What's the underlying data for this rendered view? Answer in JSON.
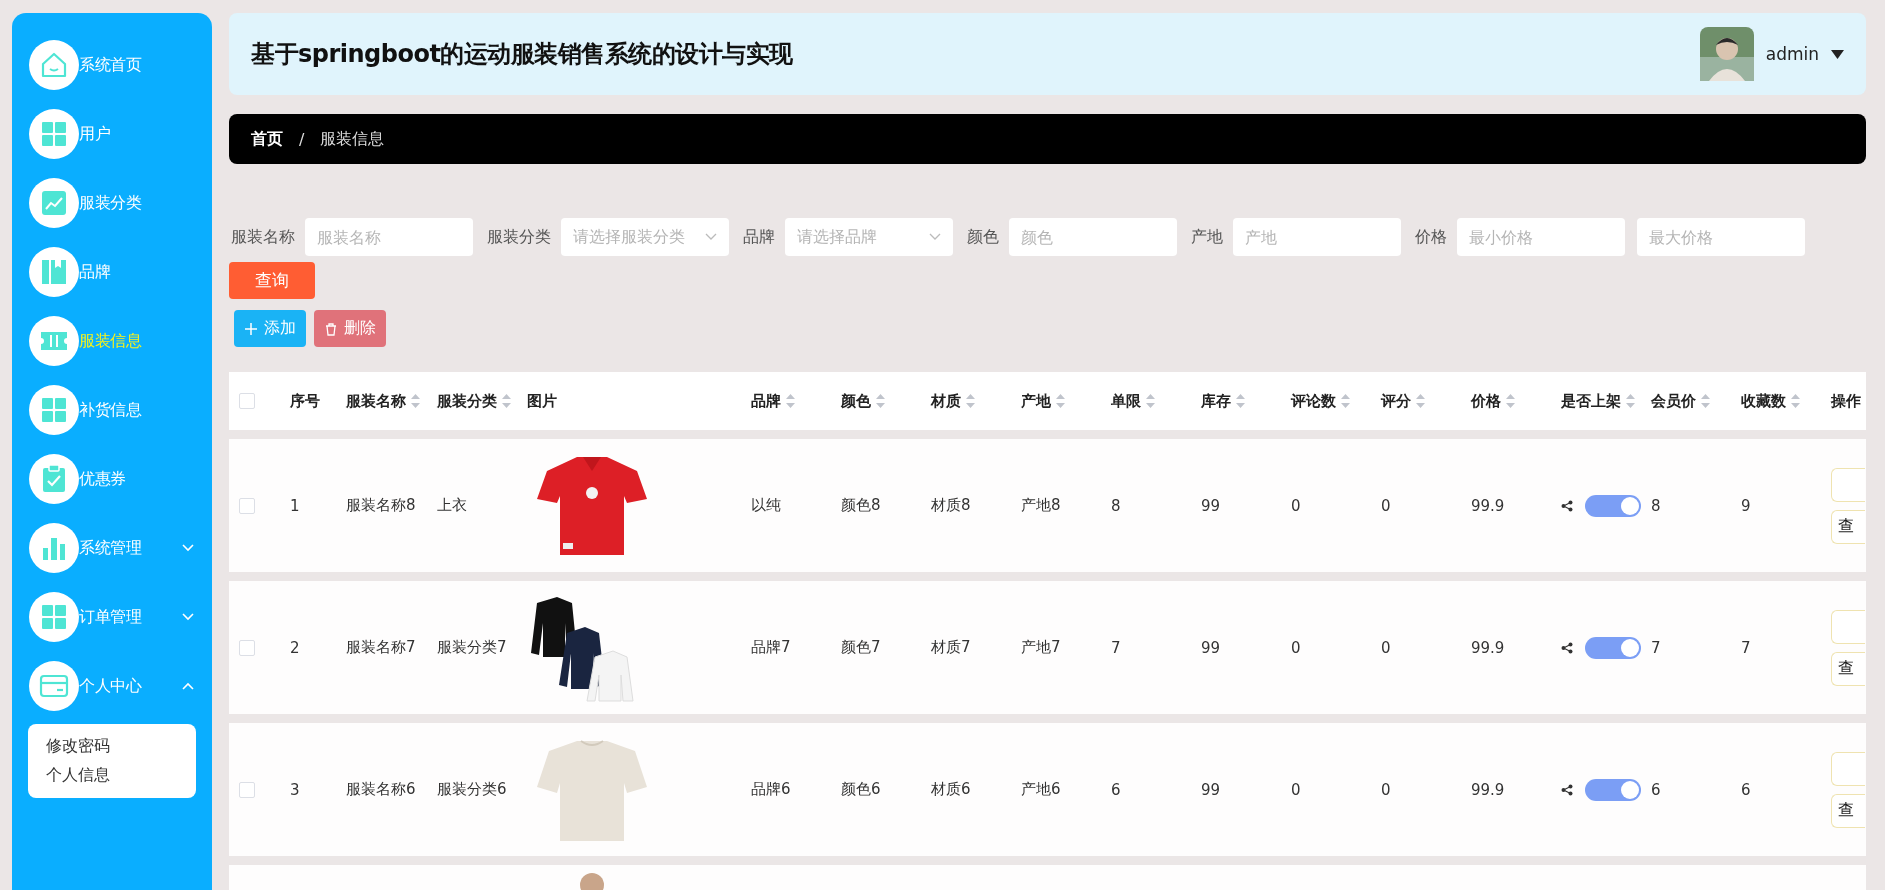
{
  "sidebar": {
    "items": [
      {
        "label": "系统首页",
        "selected": false
      },
      {
        "label": "用户",
        "selected": false
      },
      {
        "label": "服装分类",
        "selected": false
      },
      {
        "label": "品牌",
        "selected": false
      },
      {
        "label": "服装信息",
        "selected": true
      },
      {
        "label": "补货信息",
        "selected": false
      },
      {
        "label": "优惠券",
        "selected": false
      },
      {
        "label": "系统管理",
        "selected": false,
        "expanded": false
      },
      {
        "label": "订单管理",
        "selected": false,
        "expanded": false
      },
      {
        "label": "个人中心",
        "selected": false,
        "expanded": true,
        "children": [
          {
            "label": "修改密码"
          },
          {
            "label": "个人信息"
          }
        ]
      }
    ]
  },
  "header": {
    "title": "基于springboot的运动服装销售系统的设计与实现",
    "user": {
      "name": "admin"
    }
  },
  "breadcrumb": {
    "items": [
      "首页",
      "服装信息"
    ],
    "separator": "/"
  },
  "search": {
    "fields": [
      {
        "label": "服装名称",
        "placeholder": "服装名称",
        "kind": "input"
      },
      {
        "label": "服装分类",
        "placeholder": "请选择服装分类",
        "kind": "select"
      },
      {
        "label": "品牌",
        "placeholder": "请选择品牌",
        "kind": "select"
      },
      {
        "label": "颜色",
        "placeholder": "颜色",
        "kind": "input"
      },
      {
        "label": "产地",
        "placeholder": "产地",
        "kind": "input"
      },
      {
        "label": "价格",
        "placeholder": "最小价格",
        "kind": "input"
      },
      {
        "placeholder": "最大价格",
        "kind": "input"
      }
    ],
    "button": "查询"
  },
  "actions": [
    {
      "label": "添加",
      "kind": "add"
    },
    {
      "label": "删除",
      "kind": "delete"
    }
  ],
  "table": {
    "all_checked": false,
    "columns": [
      {
        "label": "序号",
        "sortable": false
      },
      {
        "label": "服装名称",
        "sortable": true
      },
      {
        "label": "服装分类",
        "sortable": true
      },
      {
        "label": "图片",
        "sortable": false
      },
      {
        "label": "品牌",
        "sortable": true
      },
      {
        "label": "颜色",
        "sortable": true
      },
      {
        "label": "材质",
        "sortable": true
      },
      {
        "label": "产地",
        "sortable": true
      },
      {
        "label": "单限",
        "sortable": true
      },
      {
        "label": "库存",
        "sortable": true
      },
      {
        "label": "评论数",
        "sortable": true
      },
      {
        "label": "评分",
        "sortable": true
      },
      {
        "label": "价格",
        "sortable": true
      },
      {
        "label": "是否上架",
        "sortable": true
      },
      {
        "label": "会员价",
        "sortable": true
      },
      {
        "label": "收藏数",
        "sortable": true
      },
      {
        "label": "操作"
      }
    ],
    "rows": [
      {
        "checked": false,
        "cells": [
          "1",
          "服装名称8",
          "上衣",
          {
            "kind": "picture"
          },
          "以纯",
          "颜色8",
          "材质8",
          "产地8",
          "8",
          "99",
          "0",
          "0",
          "99.9",
          {
            "on": true
          },
          "8",
          "9"
        ],
        "action": "查"
      },
      {
        "checked": false,
        "cells": [
          "2",
          "服装名称7",
          "服装分类7",
          {
            "kind": "picture"
          },
          "品牌7",
          "颜色7",
          "材质7",
          "产地7",
          "7",
          "99",
          "0",
          "0",
          "99.9",
          {
            "on": true
          },
          "7",
          "7"
        ],
        "action": "查"
      },
      {
        "checked": false,
        "cells": [
          "3",
          "服装名称6",
          "服装分类6",
          {
            "kind": "picture"
          },
          "品牌6",
          "颜色6",
          "材质6",
          "产地6",
          "6",
          "99",
          "0",
          "0",
          "99.9",
          {
            "on": true
          },
          "6",
          "6"
        ],
        "action": "查"
      },
      {
        "cells": [
          null,
          null,
          null,
          {
            "kind": "picture"
          }
        ]
      }
    ]
  }
}
